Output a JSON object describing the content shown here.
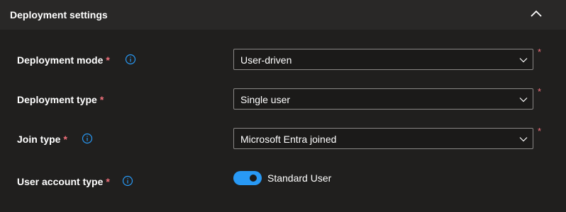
{
  "section": {
    "title": "Deployment settings",
    "collapse_icon": "chevron-up-icon"
  },
  "required_marker": "*",
  "fields": [
    {
      "label": "Deployment mode",
      "value": "User-driven",
      "info_icon": "info-icon"
    },
    {
      "label": "Deployment type",
      "value": "Single user"
    },
    {
      "label": "Join type",
      "value": "Microsoft Entra joined",
      "info_icon": "info-icon"
    },
    {
      "label": "User account type",
      "toggle_label": "Standard User",
      "toggle_on": true,
      "info_icon": "info-icon"
    }
  ],
  "colors": {
    "accent": "#2899f5",
    "required": "#f1707b",
    "background": "#201f1e",
    "header": "#292827"
  }
}
